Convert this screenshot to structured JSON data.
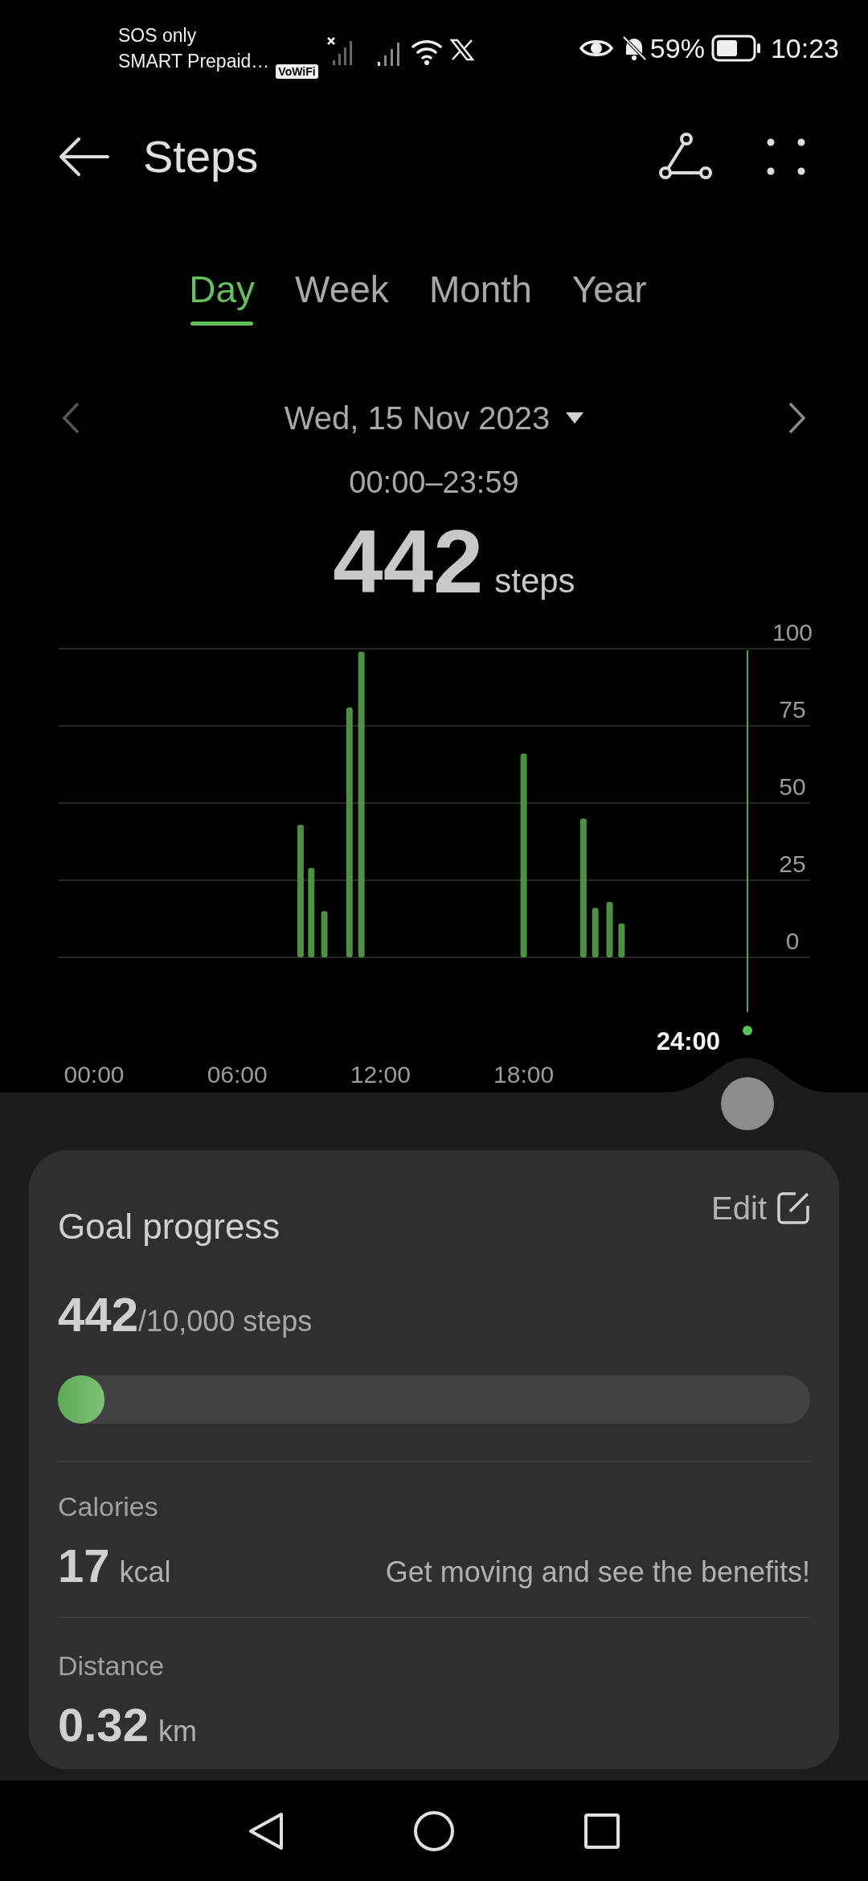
{
  "status_bar": {
    "carrier_lines": [
      "SOS only",
      "SMART Prepaid…"
    ],
    "vowifi_badge": "VoWiFi",
    "battery_text": "59%",
    "time": "10:23"
  },
  "header": {
    "title": "Steps"
  },
  "tabs": [
    {
      "label": "Day",
      "selected": true
    },
    {
      "label": "Week",
      "selected": false
    },
    {
      "label": "Month",
      "selected": false
    },
    {
      "label": "Year",
      "selected": false
    }
  ],
  "date_selector": {
    "date": "Wed, 15 Nov 2023",
    "time_range": "00:00–23:59"
  },
  "total": {
    "value": "442",
    "unit": "steps"
  },
  "chart": {
    "cursor_label": "24:00",
    "chart_data": {
      "type": "bar",
      "grid": true,
      "x": [
        8.65,
        9.1,
        9.65,
        10.7,
        11.2,
        18,
        20.5,
        21,
        21.6,
        22.1
      ],
      "series": [
        {
          "color": "#4e8f45",
          "values": [
            43,
            29,
            15,
            81,
            99,
            66,
            45,
            16,
            18,
            11
          ]
        }
      ],
      "xlim": [
        -1.5,
        30
      ],
      "ylim": [
        0,
        100
      ],
      "xticks": [
        {
          "value": 0,
          "label": "00:00"
        },
        {
          "value": 6,
          "label": "06:00"
        },
        {
          "value": 12,
          "label": "12:00"
        },
        {
          "value": 18,
          "label": "18:00"
        }
      ],
      "yticks": [
        0,
        25,
        50,
        75,
        100
      ]
    }
  },
  "goal_card": {
    "title": "Goal progress",
    "edit_label": "Edit",
    "current": "442",
    "goal_text": "/10,000 steps",
    "level": 0.0442,
    "stats": [
      {
        "label": "Calories",
        "value": "17",
        "unit": "kcal",
        "note": "Get moving and see the benefits!"
      },
      {
        "label": "Distance",
        "value": "0.32",
        "unit": "km"
      }
    ]
  }
}
